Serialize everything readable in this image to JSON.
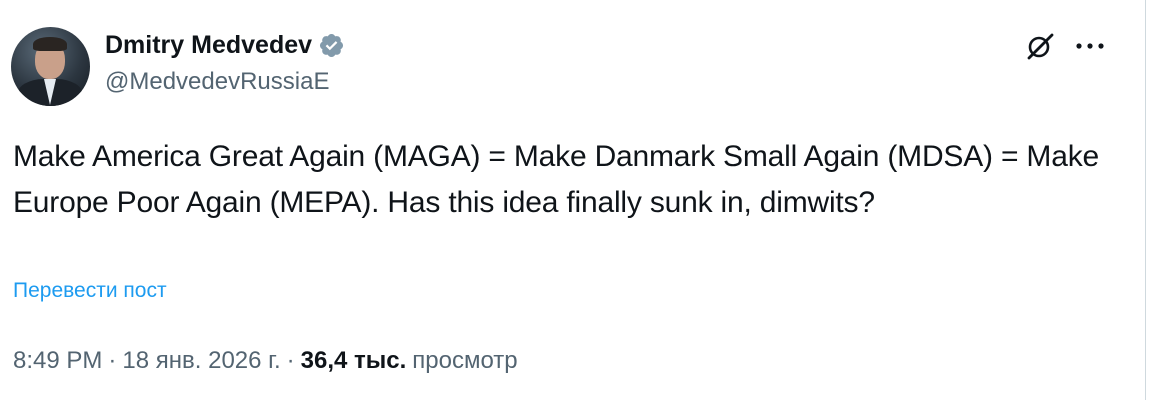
{
  "author": {
    "display_name": "Dmitry Medvedev",
    "handle": "@MedvedevRussiaE",
    "verified": true
  },
  "tweet": {
    "text": "Make America Great Again (MAGA) = Make Danmark Small Again (MDSA) = Make Europe Poor Again (MEPA). Has this idea finally sunk in, dimwits?",
    "translate_label": "Перевести пост",
    "time": "8:49 PM",
    "date": "18 янв. 2026 г.",
    "separator": "·",
    "views_count": "36,4 тыс.",
    "views_label": "просмотр"
  },
  "icons": {
    "avatar": "avatar",
    "verified": "verified-badge-icon",
    "grok": "grok-icon",
    "more": "more-icon"
  },
  "colors": {
    "text_primary": "#0f1419",
    "text_secondary": "#536471",
    "link": "#1d9bf0",
    "verified": "#829aab",
    "border": "#cfd9de"
  }
}
